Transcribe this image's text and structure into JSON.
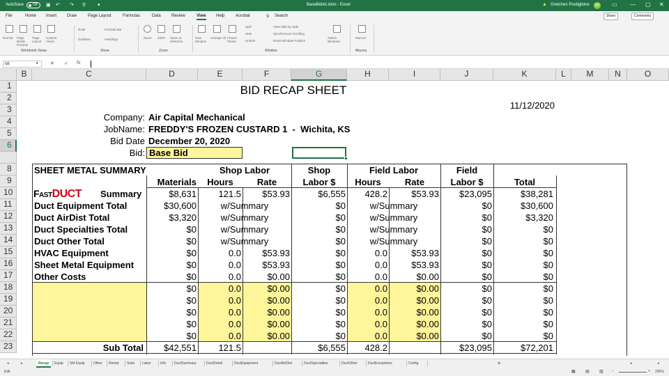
{
  "titlebar": {
    "autosave": "AutoSave",
    "autosave_state": "Off",
    "document": "BaseBidsh.xlsm - Excel",
    "user": "Gretchen Postiglione",
    "user_initials": "GP"
  },
  "menu": {
    "items": [
      "File",
      "Home",
      "Insert",
      "Draw",
      "Page Layout",
      "Formulas",
      "Data",
      "Review",
      "View",
      "Help",
      "Acrobat"
    ],
    "active": "View",
    "search": "Search",
    "share": "Share",
    "comments": "Comments"
  },
  "ribbon": {
    "groups": {
      "workbook_views": "Workbook Views",
      "show": "Show",
      "zoom": "Zoom",
      "window": "Window",
      "macros": "Macros"
    },
    "workbook_views": [
      "Normal",
      "Page Break Preview",
      "Page Layout",
      "Custom Views"
    ],
    "show": [
      "Ruler",
      "Formula Bar",
      "Gridlines",
      "Headings"
    ],
    "zoom": [
      "Zoom",
      "100%",
      "Zoom to Selection"
    ],
    "window": [
      "New Window",
      "Arrange All",
      "Freeze Panes",
      "Split",
      "Hide",
      "Unhide",
      "View Side by Side",
      "Synchronous Scrolling",
      "Reset Window Position",
      "Switch Windows"
    ],
    "macros": [
      "Macros"
    ]
  },
  "formula_bar": {
    "name_box": "G6",
    "fx": "fx",
    "cancel": "✕",
    "enter": "✓",
    "value": ""
  },
  "columns": [
    "B",
    "C",
    "D",
    "E",
    "F",
    "G",
    "H",
    "I",
    "J",
    "K",
    "L",
    "M",
    "N",
    "O"
  ],
  "rows": [
    "1",
    "2",
    "3",
    "4",
    "5",
    "6",
    "",
    "8",
    "9",
    "10",
    "11",
    "12",
    "13",
    "14",
    "15",
    "16",
    "17",
    "18",
    "19",
    "20",
    "21",
    "22",
    "23"
  ],
  "selected_cell": "G6",
  "sheet": {
    "title": "BID RECAP SHEET",
    "date": "11/12/2020",
    "company_label": "Company:",
    "company": "Air Capital Mechanical",
    "jobname_label": "JobName:",
    "jobname": "FREDDY'S FROZEN CUSTARD 1  -  Wichita, KS",
    "biddate_label": "Bid Date",
    "biddate": "December 20, 2020",
    "bid_label": "Bid:",
    "bid": "Base Bid",
    "summary_title": "SHEET METAL SUMMARY",
    "hdr": {
      "shop_labor": "Shop Labor",
      "shop": "Shop",
      "field_labor": "Field Labor",
      "field": "Field",
      "materials": "Materials",
      "hours": "Hours",
      "rate": "Rate",
      "labor": "Labor $",
      "hours2": "Hours",
      "rate2": "Rate",
      "labor2": "Labor $",
      "total": "Total"
    },
    "fastduct": {
      "fast": "Fast",
      "duct": "DUCT",
      "summary": "Summary"
    },
    "lines": [
      {
        "label": "",
        "materials": "$8,631",
        "shop_hours": "121.5",
        "shop_rate": "$53.93",
        "shop_labor": "$6,555",
        "field_hours": "428.2",
        "field_rate": "$53.93",
        "field_labor": "$23,095",
        "total": "$38,281"
      },
      {
        "label": "Duct Equipment Total",
        "materials": "$30,600",
        "shop_hours": "w/Summary",
        "shop_rate": "",
        "shop_labor": "$0",
        "field_hours": "w/Summary",
        "field_rate": "",
        "field_labor": "$0",
        "total": "$30,600"
      },
      {
        "label": "Duct AirDist Total",
        "materials": "$3,320",
        "shop_hours": "w/Summary",
        "shop_rate": "",
        "shop_labor": "$0",
        "field_hours": "w/Summary",
        "field_rate": "",
        "field_labor": "$0",
        "total": "$3,320"
      },
      {
        "label": "Duct Specialties Total",
        "materials": "$0",
        "shop_hours": "w/Summary",
        "shop_rate": "",
        "shop_labor": "$0",
        "field_hours": "w/Summary",
        "field_rate": "",
        "field_labor": "$0",
        "total": "$0"
      },
      {
        "label": "Duct Other Total",
        "materials": "$0",
        "shop_hours": "w/Summary",
        "shop_rate": "",
        "shop_labor": "$0",
        "field_hours": "w/Summary",
        "field_rate": "",
        "field_labor": "$0",
        "total": "$0"
      },
      {
        "label": "HVAC Equipment",
        "materials": "$0",
        "shop_hours": "0.0",
        "shop_rate": "$53.93",
        "shop_labor": "$0",
        "field_hours": "0.0",
        "field_rate": "$53.93",
        "field_labor": "$0",
        "total": "$0"
      },
      {
        "label": "Sheet Metal Equipment",
        "materials": "$0",
        "shop_hours": "0.0",
        "shop_rate": "$53.93",
        "shop_labor": "$0",
        "field_hours": "0.0",
        "field_rate": "$53.93",
        "field_labor": "$0",
        "total": "$0"
      },
      {
        "label": "Other Costs",
        "materials": "$0",
        "shop_hours": "0.0",
        "shop_rate": "$0.00",
        "shop_labor": "$0",
        "field_hours": "0.0",
        "field_rate": "$0.00",
        "field_labor": "$0",
        "total": "$0"
      },
      {
        "label": "",
        "materials": "$0",
        "shop_hours": "0.0",
        "shop_rate": "$0.00",
        "shop_labor": "$0",
        "field_hours": "0.0",
        "field_rate": "$0.00",
        "field_labor": "$0",
        "total": "$0"
      },
      {
        "label": "",
        "materials": "$0",
        "shop_hours": "0.0",
        "shop_rate": "$0.00",
        "shop_labor": "$0",
        "field_hours": "0.0",
        "field_rate": "$0.00",
        "field_labor": "$0",
        "total": "$0"
      },
      {
        "label": "",
        "materials": "$0",
        "shop_hours": "0.0",
        "shop_rate": "$0.00",
        "shop_labor": "$0",
        "field_hours": "0.0",
        "field_rate": "$0.00",
        "field_labor": "$0",
        "total": "$0"
      },
      {
        "label": "",
        "materials": "$0",
        "shop_hours": "0.0",
        "shop_rate": "$0.00",
        "shop_labor": "$0",
        "field_hours": "0.0",
        "field_rate": "$0.00",
        "field_labor": "$0",
        "total": "$0"
      },
      {
        "label": "",
        "materials": "$0",
        "shop_hours": "0.0",
        "shop_rate": "$0.00",
        "shop_labor": "$0",
        "field_hours": "0.0",
        "field_rate": "$0.00",
        "field_labor": "$0",
        "total": "$0"
      }
    ],
    "subtotal": {
      "label": "Sub Total",
      "materials": "$42,551",
      "shop_hours": "121.5",
      "shop_labor": "$6,555",
      "field_hours": "428.2",
      "field_labor": "$23,095",
      "total": "$72,201"
    }
  },
  "sheet_tabs": [
    "Recap",
    "Equip",
    "SM Equip",
    "Other",
    "Rental",
    "Subs",
    "Labor",
    "Info",
    "DuctSummary",
    "DuctDetail",
    "DuctEquipment",
    "DuctAirDist",
    "DuctSpecialties",
    "DuctOther",
    "DuctExceptions",
    "Config"
  ],
  "active_tab": "Recap",
  "status": {
    "mode": "Edit",
    "zoom": "200%"
  },
  "colors": {
    "excel_green": "#217346",
    "input_yellow": "#fff59a",
    "fastduct_red": "#d0021b"
  }
}
